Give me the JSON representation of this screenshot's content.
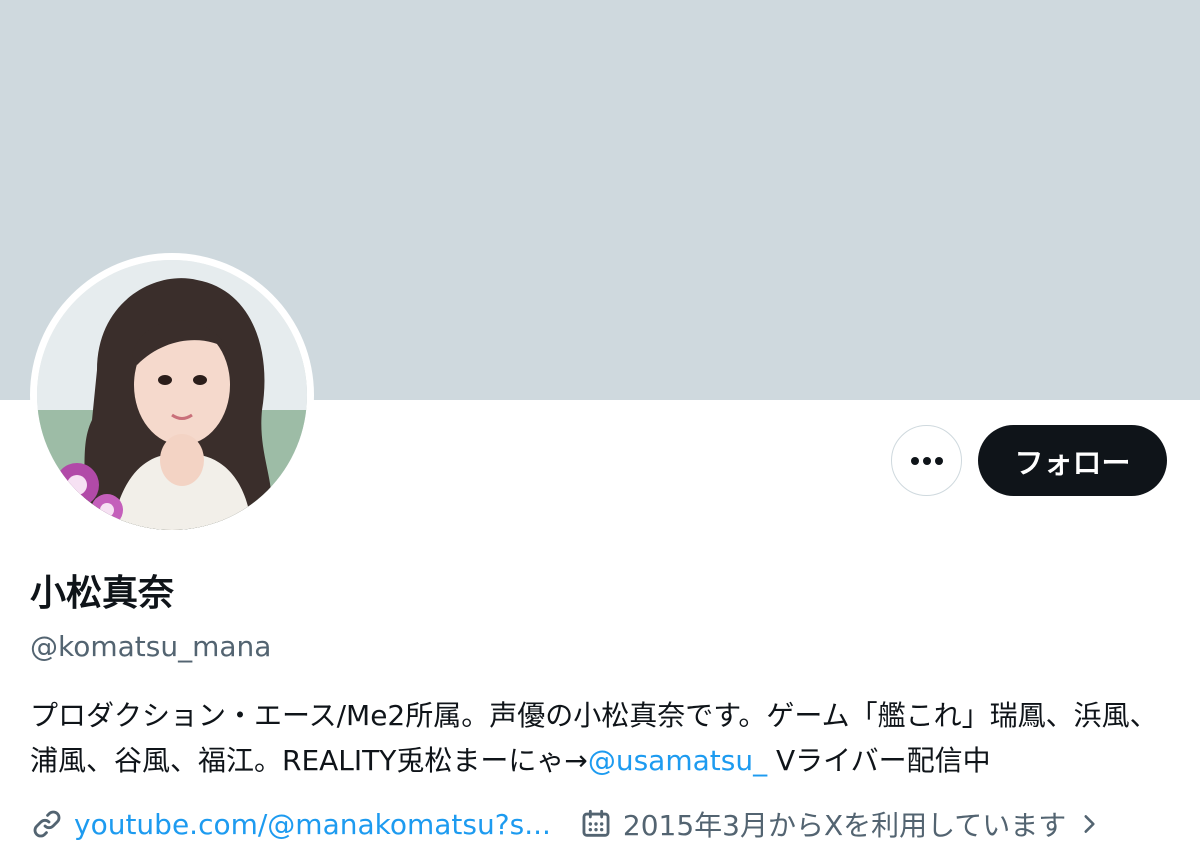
{
  "profile": {
    "display_name": "小松真奈",
    "handle": "@komatsu_mana",
    "bio_before": "プロダクション・エース/Me2所属。声優の小松真奈です。ゲーム「艦これ」瑞鳳、浜風、浦風、谷風、福江。REALITY兎松まーにゃ→",
    "bio_mention": "@usamatsu_",
    "bio_after": " Vライバー配信中",
    "website": "youtube.com/@manakomatsu?s...",
    "joined": "2015年3月からXを利用しています"
  },
  "actions": {
    "follow_label": "フォロー",
    "more_icon": "more-dots-icon"
  },
  "icons": {
    "link": "link-icon",
    "calendar": "calendar-icon",
    "chevron": "chevron-right-icon"
  },
  "colors": {
    "banner": "#cfd9de",
    "accent": "#1d9bf0",
    "text": "#0f1419",
    "secondary": "#536471"
  }
}
